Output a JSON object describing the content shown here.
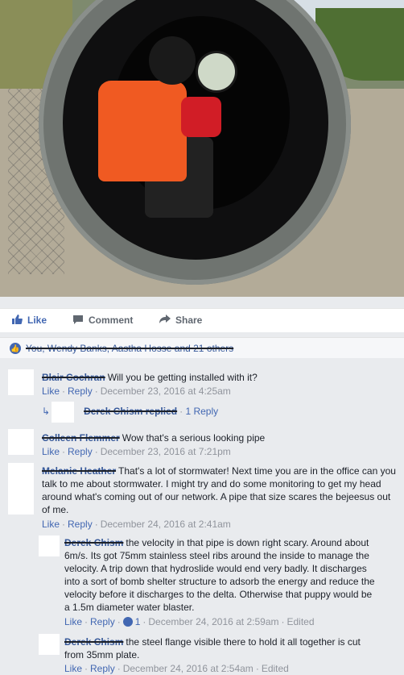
{
  "post": {
    "actions": {
      "like": "Like",
      "comment": "Comment",
      "share": "Share"
    },
    "likes_summary": "You, Wendy Banks, Aastha Hosse and 21 others"
  },
  "comments": [
    {
      "author": "Blair Cochran",
      "text": "Will you be getting installed with it?",
      "like": "Like",
      "reply": "Reply",
      "time": "December 23, 2016 at 4:25am",
      "replies_summary": {
        "author": "Derek Chism replied",
        "count": "1 Reply"
      }
    },
    {
      "author": "Colleen Flemmer",
      "text": "Wow that's a serious looking pipe",
      "like": "Like",
      "reply": "Reply",
      "time": "December 23, 2016 at 7:21pm"
    },
    {
      "author": "Melanie Heather",
      "text": "That's a lot of stormwater! Next time you are in the office can you talk to me about stormwater. I might try and do some monitoring to get my head around what's coming out of our network. A pipe that size scares the bejeesus out of me.",
      "like": "Like",
      "reply": "Reply",
      "time": "December 24, 2016 at 2:41am",
      "replies": [
        {
          "author": "Derek Chism",
          "text": "the velocity in that pipe is down right scary. Around about 6m/s. Its got 75mm stainless steel ribs around the inside to manage the velocity. A trip down that hydroslide would end very badly. It discharges into a sort of bomb shelter structure to adsorb the energy and reduce the velocity before it discharges to the delta. Otherwise that puppy would be a 1.5m diameter water blaster.",
          "like": "Like",
          "reply": "Reply",
          "reactions": "1",
          "time": "December 24, 2016 at 2:59am",
          "edited": "Edited"
        },
        {
          "author": "Derek Chism",
          "text": "the steel flange visible there to hold it all together is cut from 35mm plate.",
          "like": "Like",
          "reply": "Reply",
          "time": "December 24, 2016 at 2:54am",
          "edited": "Edited"
        }
      ]
    }
  ],
  "colors": {
    "link": "#4267b2",
    "meta": "#90949c",
    "background": "#e9ebee"
  },
  "icons": {
    "like": "thumbs-up-icon",
    "comment": "comment-bubble-icon",
    "share": "share-arrow-icon"
  }
}
